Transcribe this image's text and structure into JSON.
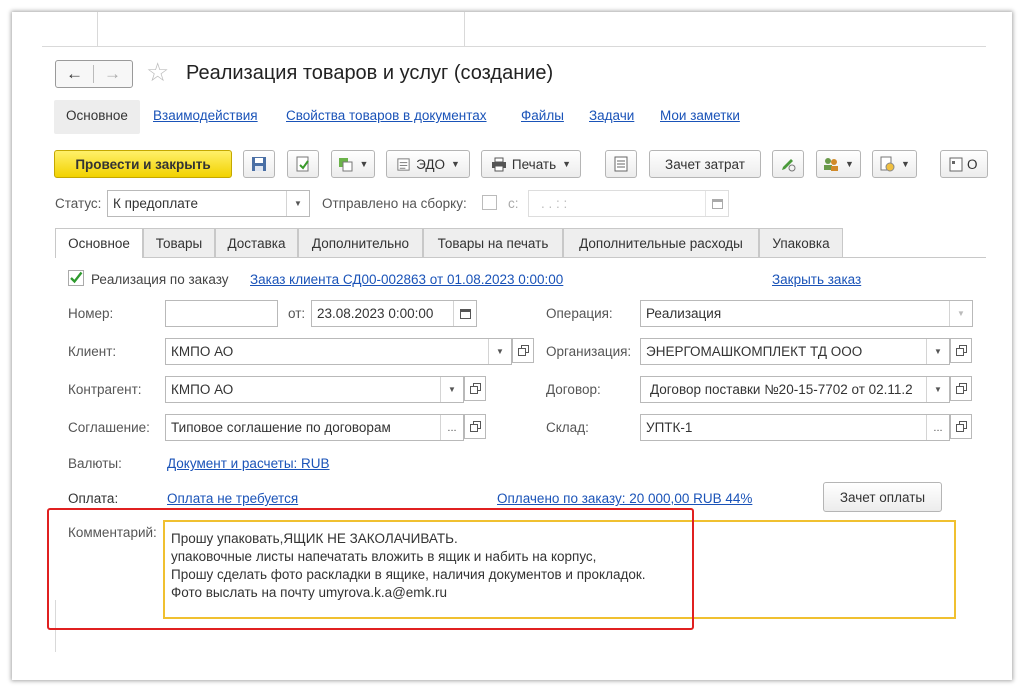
{
  "window": {
    "title": "Реализация товаров и услуг (создание)"
  },
  "top_tabs": [
    "Основное",
    "Взаимодействия",
    "Свойства товаров в документах",
    "Файлы",
    "Задачи",
    "Мои заметки"
  ],
  "toolbar": {
    "post_close": "Провести и закрыть",
    "edo": "ЭДО",
    "print": "Печать",
    "cost_offset": "Зачет затрат",
    "cut_label": "О"
  },
  "status": {
    "label": "Статус:",
    "value": "К предоплате",
    "sent_label": "Отправлено на сборку:",
    "from_label": "с:",
    "date_placeholder": ". .    : :"
  },
  "tabs": [
    "Основное",
    "Товары",
    "Доставка",
    "Дополнительно",
    "Товары на печать",
    "Дополнительные расходы",
    "Упаковка"
  ],
  "order": {
    "checkbox_label": "Реализация по заказу",
    "order_link": "Заказ клиента СД00-002863 от 01.08.2023 0:00:00",
    "close_link": "Закрыть заказ"
  },
  "form": {
    "number_label": "Номер:",
    "number_value": "",
    "from_label": "от:",
    "date_value": "23.08.2023  0:00:00",
    "operation_label": "Операция:",
    "operation_value": "Реализация",
    "client_label": "Клиент:",
    "client_value": "КМПО АО",
    "org_label": "Организация:",
    "org_value": "ЭНЕРГОМАШКОМПЛЕКТ ТД ООО",
    "contractor_label": "Контрагент:",
    "contractor_value": "КМПО АО",
    "contract_label": "Договор:",
    "contract_value": "Договор поставки №20-15-7702 от 02.11.2",
    "agreement_label": "Соглашение:",
    "agreement_value": "Типовое соглашение по договорам",
    "warehouse_label": "Склад:",
    "warehouse_value": "УПТК-1",
    "currency_label": "Валюты:",
    "currency_link": "Документ и расчеты: RUB",
    "payment_label": "Оплата:",
    "payment_link": "Оплата не требуется",
    "paid_link": "Оплачено по заказу: 20 000,00 RUB  44%",
    "payment_offset_btn": "Зачет оплаты",
    "comment_label": "Комментарий:",
    "comment_lines": [
      "Прошу упаковать,ЯЩИК НЕ ЗАКОЛАЧИВАТЬ.",
      "упаковочные листы напечатать вложить в ящик и набить на корпус,",
      "Прошу сделать фото раскладки в ящике, наличия документов и прокладок.",
      "Фото выслать на почту umyrova.k.a@emk.ru"
    ]
  },
  "colors": {
    "link": "#1a53b8",
    "primary_button": "#f2d200",
    "highlight_border": "#e02020",
    "focus_border": "#f0c030"
  }
}
